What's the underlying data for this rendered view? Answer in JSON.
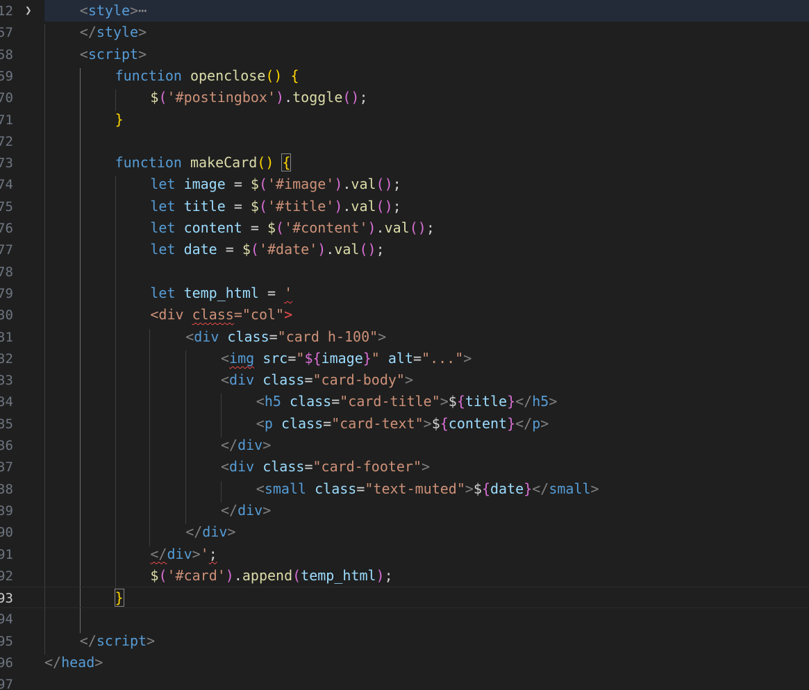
{
  "editor": {
    "language": "html",
    "current_line": "93",
    "colors": {
      "background": "#1f1f1f",
      "tag_bracket": "#808080",
      "tag_name": "#569cd6",
      "keyword": "#569cd6",
      "function": "#dcdcaa",
      "variable": "#9cdcfe",
      "string": "#ce9178",
      "bracket_gold": "#ffd700",
      "bracket_pink": "#da70d6",
      "bracket_blue": "#179fff",
      "plain": "#d4d4d4",
      "error": "#f14c4c"
    },
    "icons": {
      "fold": "chevron-right-icon"
    },
    "lines": [
      {
        "number": "12",
        "folded": true,
        "segments": [
          [
            "tb",
            "<"
          ],
          [
            "tag",
            "style"
          ],
          [
            "tb",
            ">"
          ],
          [
            "ell",
            "⋯"
          ]
        ]
      },
      {
        "number": "57",
        "segments": [
          [
            "tb",
            "</"
          ],
          [
            "tag",
            "style"
          ],
          [
            "tb",
            ">"
          ]
        ]
      },
      {
        "number": "58",
        "segments": [
          [
            "tb",
            "<"
          ],
          [
            "tag",
            "script"
          ],
          [
            "tb",
            ">"
          ]
        ]
      },
      {
        "number": "59",
        "segments": [
          [
            "kw",
            "function "
          ],
          [
            "fn",
            "openclose"
          ],
          [
            "g",
            "()"
          ],
          [
            "p",
            " "
          ],
          [
            "g",
            "{"
          ]
        ]
      },
      {
        "number": "70",
        "segments": [
          [
            "fn",
            "$"
          ],
          [
            "m",
            "("
          ],
          [
            "str",
            "'#postingbox'"
          ],
          [
            "m",
            ")"
          ],
          [
            "p",
            "."
          ],
          [
            "fn",
            "toggle"
          ],
          [
            "m",
            "()"
          ],
          [
            "p",
            ";"
          ]
        ]
      },
      {
        "number": "71",
        "segments": [
          [
            "g",
            "}"
          ]
        ]
      },
      {
        "number": "72",
        "segments": []
      },
      {
        "number": "73",
        "segments": [
          [
            "kw",
            "function "
          ],
          [
            "fn",
            "makeCard"
          ],
          [
            "g",
            "()"
          ],
          [
            "p",
            " "
          ],
          [
            "gbox",
            "{"
          ]
        ]
      },
      {
        "number": "74",
        "segments": [
          [
            "kw",
            "let "
          ],
          [
            "var",
            "image"
          ],
          [
            "p",
            " = "
          ],
          [
            "fn",
            "$"
          ],
          [
            "m",
            "("
          ],
          [
            "str",
            "'#image'"
          ],
          [
            "m",
            ")"
          ],
          [
            "p",
            "."
          ],
          [
            "fn",
            "val"
          ],
          [
            "m",
            "()"
          ],
          [
            "p",
            ";"
          ]
        ]
      },
      {
        "number": "75",
        "segments": [
          [
            "kw",
            "let "
          ],
          [
            "var",
            "title"
          ],
          [
            "p",
            " = "
          ],
          [
            "fn",
            "$"
          ],
          [
            "m",
            "("
          ],
          [
            "str",
            "'#title'"
          ],
          [
            "m",
            ")"
          ],
          [
            "p",
            "."
          ],
          [
            "fn",
            "val"
          ],
          [
            "m",
            "()"
          ],
          [
            "p",
            ";"
          ]
        ]
      },
      {
        "number": "76",
        "segments": [
          [
            "kw",
            "let "
          ],
          [
            "var",
            "content"
          ],
          [
            "p",
            " = "
          ],
          [
            "fn",
            "$"
          ],
          [
            "m",
            "("
          ],
          [
            "str",
            "'#content'"
          ],
          [
            "m",
            ")"
          ],
          [
            "p",
            "."
          ],
          [
            "fn",
            "val"
          ],
          [
            "m",
            "()"
          ],
          [
            "p",
            ";"
          ]
        ]
      },
      {
        "number": "77",
        "segments": [
          [
            "kw",
            "let "
          ],
          [
            "var",
            "date"
          ],
          [
            "p",
            " = "
          ],
          [
            "fn",
            "$"
          ],
          [
            "m",
            "("
          ],
          [
            "str",
            "'#date'"
          ],
          [
            "m",
            ")"
          ],
          [
            "p",
            "."
          ],
          [
            "fn",
            "val"
          ],
          [
            "m",
            "()"
          ],
          [
            "p",
            ";"
          ]
        ]
      },
      {
        "number": "78",
        "segments": []
      },
      {
        "number": "79",
        "segments": [
          [
            "kw",
            "let "
          ],
          [
            "var",
            "temp_html"
          ],
          [
            "p",
            " = "
          ],
          [
            "strsq",
            "'"
          ]
        ]
      },
      {
        "number": "30",
        "segments": [
          [
            "str",
            "<div "
          ],
          [
            "strsq",
            "class"
          ],
          [
            "str",
            "=\"col\""
          ],
          [
            "err",
            ">"
          ]
        ]
      },
      {
        "number": "31",
        "segments": [
          [
            "tb",
            "<"
          ],
          [
            "tag",
            "div"
          ],
          [
            "p",
            " "
          ],
          [
            "var",
            "class"
          ],
          [
            "p",
            "="
          ],
          [
            "str",
            "\"card h-100\""
          ],
          [
            "tb",
            ">"
          ]
        ]
      },
      {
        "number": "32",
        "segments": [
          [
            "tb",
            "<"
          ],
          [
            "tagsq",
            "img"
          ],
          [
            "p",
            " "
          ],
          [
            "var",
            "src"
          ],
          [
            "p",
            "="
          ],
          [
            "str",
            "\""
          ],
          [
            "m",
            "${"
          ],
          [
            "var",
            "image"
          ],
          [
            "m",
            "}"
          ],
          [
            "str",
            "\""
          ],
          [
            "p",
            " "
          ],
          [
            "var",
            "alt"
          ],
          [
            "p",
            "="
          ],
          [
            "str",
            "\"...\""
          ],
          [
            "tb",
            ">"
          ]
        ]
      },
      {
        "number": "33",
        "segments": [
          [
            "tb",
            "<"
          ],
          [
            "tag",
            "div"
          ],
          [
            "p",
            " "
          ],
          [
            "var",
            "class"
          ],
          [
            "p",
            "="
          ],
          [
            "str",
            "\"card-body\""
          ],
          [
            "tb",
            ">"
          ]
        ]
      },
      {
        "number": "34",
        "segments": [
          [
            "tb",
            "<"
          ],
          [
            "tag",
            "h5"
          ],
          [
            "p",
            " "
          ],
          [
            "var",
            "class"
          ],
          [
            "p",
            "="
          ],
          [
            "str",
            "\"card-title\""
          ],
          [
            "tb",
            ">"
          ],
          [
            "p",
            "$"
          ],
          [
            "m",
            "{"
          ],
          [
            "var",
            "title"
          ],
          [
            "m",
            "}"
          ],
          [
            "tb",
            "</"
          ],
          [
            "tag",
            "h5"
          ],
          [
            "tb",
            ">"
          ]
        ]
      },
      {
        "number": "35",
        "segments": [
          [
            "tb",
            "<"
          ],
          [
            "tag",
            "p"
          ],
          [
            "p",
            " "
          ],
          [
            "var",
            "class"
          ],
          [
            "p",
            "="
          ],
          [
            "str",
            "\"card-text\""
          ],
          [
            "tb",
            ">"
          ],
          [
            "p",
            "$"
          ],
          [
            "m",
            "{"
          ],
          [
            "var",
            "content"
          ],
          [
            "m",
            "}"
          ],
          [
            "tb",
            "</"
          ],
          [
            "tag",
            "p"
          ],
          [
            "tb",
            ">"
          ]
        ]
      },
      {
        "number": "36",
        "segments": [
          [
            "tb",
            "</"
          ],
          [
            "tag",
            "div"
          ],
          [
            "tb",
            ">"
          ]
        ]
      },
      {
        "number": "37",
        "segments": [
          [
            "tb",
            "<"
          ],
          [
            "tag",
            "div"
          ],
          [
            "p",
            " "
          ],
          [
            "var",
            "class"
          ],
          [
            "p",
            "="
          ],
          [
            "str",
            "\"card-footer\""
          ],
          [
            "tb",
            ">"
          ]
        ]
      },
      {
        "number": "38",
        "segments": [
          [
            "tb",
            "<"
          ],
          [
            "tag",
            "small"
          ],
          [
            "p",
            " "
          ],
          [
            "var",
            "class"
          ],
          [
            "p",
            "="
          ],
          [
            "str",
            "\"text-muted\""
          ],
          [
            "tb",
            ">"
          ],
          [
            "p",
            "$"
          ],
          [
            "m",
            "{"
          ],
          [
            "var",
            "date"
          ],
          [
            "m",
            "}"
          ],
          [
            "tb",
            "</"
          ],
          [
            "tag",
            "small"
          ],
          [
            "tb",
            ">"
          ]
        ]
      },
      {
        "number": "39",
        "segments": [
          [
            "tb",
            "</"
          ],
          [
            "tag",
            "div"
          ],
          [
            "tb",
            ">"
          ]
        ]
      },
      {
        "number": "90",
        "segments": [
          [
            "tb",
            "</"
          ],
          [
            "tag",
            "div"
          ],
          [
            "tb",
            ">"
          ]
        ]
      },
      {
        "number": "91",
        "segments": [
          [
            "tbsq",
            "</"
          ],
          [
            "tag",
            "div"
          ],
          [
            "tb",
            ">"
          ],
          [
            "str",
            "'"
          ],
          [
            "psq",
            ";"
          ]
        ]
      },
      {
        "number": "92",
        "segments": [
          [
            "fn",
            "$"
          ],
          [
            "m",
            "("
          ],
          [
            "str",
            "'#card'"
          ],
          [
            "m",
            ")"
          ],
          [
            "p",
            "."
          ],
          [
            "fn",
            "append"
          ],
          [
            "m",
            "("
          ],
          [
            "var",
            "temp_html"
          ],
          [
            "m",
            ")"
          ],
          [
            "p",
            ";"
          ]
        ]
      },
      {
        "number": "93",
        "segments": [
          [
            "gbox",
            "}"
          ]
        ]
      },
      {
        "number": "94",
        "segments": []
      },
      {
        "number": "95",
        "segments": [
          [
            "tb",
            "</"
          ],
          [
            "tag",
            "script"
          ],
          [
            "tb",
            ">"
          ]
        ]
      },
      {
        "number": "96",
        "segments": [
          [
            "tb",
            "</"
          ],
          [
            "tag",
            "head"
          ],
          [
            "tb",
            ">"
          ]
        ]
      },
      {
        "number": "97",
        "segments": []
      }
    ]
  }
}
